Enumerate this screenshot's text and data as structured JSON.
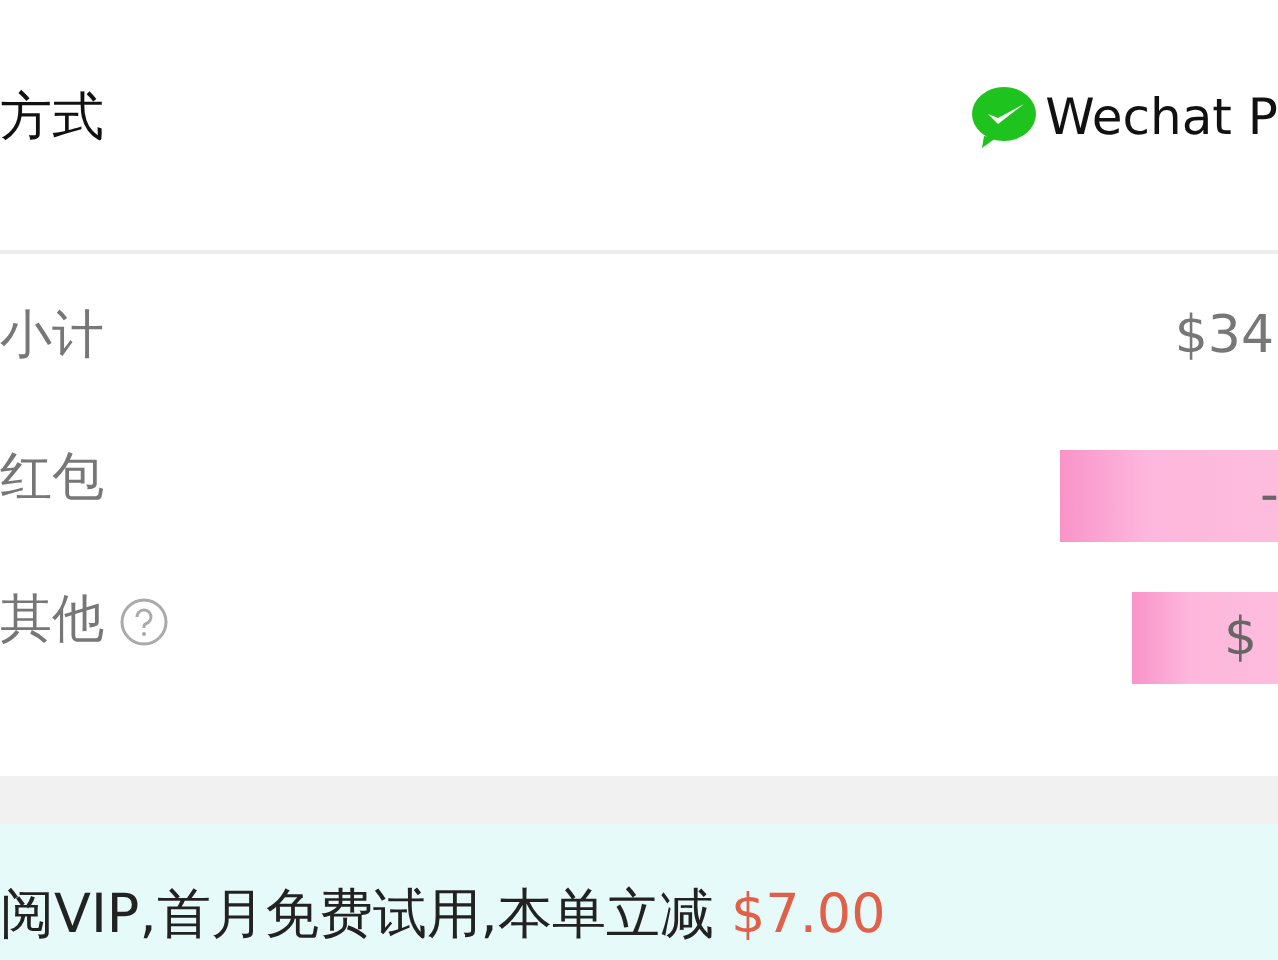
{
  "payment": {
    "label": "方式",
    "method": "Wechat P"
  },
  "summary": [
    {
      "label": "小计",
      "value": "$34",
      "kind": "plain",
      "help": false
    },
    {
      "label": "红包",
      "value": "-",
      "kind": "tag",
      "help": false
    },
    {
      "label": "其他",
      "value": "$",
      "kind": "tag",
      "help": true
    }
  ],
  "promo": {
    "text": "阅VIP,首月免费试用,本单立减",
    "amount": "$7.00"
  }
}
